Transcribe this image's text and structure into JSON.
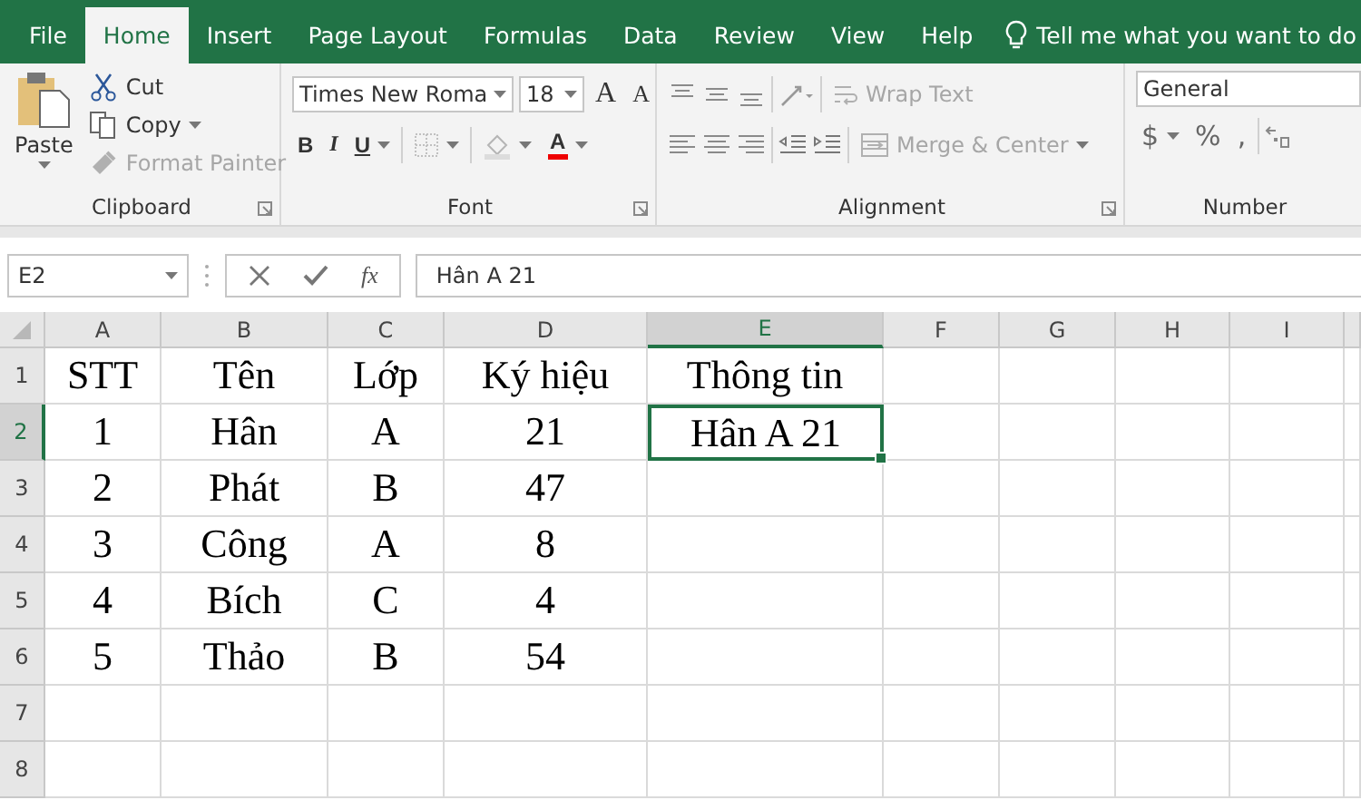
{
  "tabs": [
    {
      "label": "File",
      "selected": false
    },
    {
      "label": "Home",
      "selected": true
    },
    {
      "label": "Insert",
      "selected": false
    },
    {
      "label": "Page Layout",
      "selected": false
    },
    {
      "label": "Formulas",
      "selected": false
    },
    {
      "label": "Data",
      "selected": false
    },
    {
      "label": "Review",
      "selected": false
    },
    {
      "label": "View",
      "selected": false
    },
    {
      "label": "Help",
      "selected": false
    }
  ],
  "tell_me": "Tell me what you want to do",
  "ribbon": {
    "clipboard": {
      "label": "Clipboard",
      "items": [
        {
          "kind": "paste",
          "label": "Paste",
          "disabled": false
        },
        {
          "kind": "cut",
          "label": "Cut",
          "disabled": false
        },
        {
          "kind": "copy",
          "label": "Copy",
          "disabled": false
        },
        {
          "kind": "format_painter",
          "label": "Format Painter",
          "disabled": true
        }
      ]
    },
    "font": {
      "label": "Font",
      "rows": [
        {
          "items": [
            {
              "kind": "font_name",
              "value": "Times New Roma"
            },
            {
              "kind": "font_size",
              "value": "18"
            },
            {
              "kind": "grow",
              "label": "A"
            },
            {
              "kind": "shrink",
              "label": "A"
            }
          ]
        },
        {
          "items": [
            {
              "kind": "bold",
              "label": "B"
            },
            {
              "kind": "italic",
              "label": "I"
            },
            {
              "kind": "underline",
              "label": "U"
            },
            {
              "kind": "borders",
              "disabled": true
            },
            {
              "kind": "fill",
              "disabled": true
            },
            {
              "kind": "font_color",
              "label": "A"
            }
          ]
        }
      ]
    },
    "alignment": {
      "label": "Alignment",
      "rows": [
        {
          "items": [
            {
              "kind": "align_top"
            },
            {
              "kind": "align_middle"
            },
            {
              "kind": "align_bottom"
            },
            {
              "kind": "orientation"
            },
            {
              "kind": "wrap_text",
              "label": "Wrap Text",
              "disabled": true
            }
          ]
        },
        {
          "items": [
            {
              "kind": "align_left"
            },
            {
              "kind": "align_center"
            },
            {
              "kind": "align_right"
            },
            {
              "kind": "outdent"
            },
            {
              "kind": "indent"
            },
            {
              "kind": "merge_center",
              "label": "Merge & Center",
              "disabled": true
            }
          ]
        }
      ]
    },
    "number": {
      "label": "Number",
      "format": "General",
      "items": [
        {
          "kind": "currency",
          "label": "$"
        },
        {
          "kind": "percent",
          "label": "%"
        },
        {
          "kind": "comma",
          "label": ","
        },
        {
          "kind": "decimal"
        }
      ]
    }
  },
  "formula_bar": {
    "name_box": "E2",
    "function_label": "fx",
    "formula": "Hân A 21"
  },
  "grid": {
    "columns": [
      {
        "label": "A",
        "selected": false
      },
      {
        "label": "B",
        "selected": false
      },
      {
        "label": "C",
        "selected": false
      },
      {
        "label": "D",
        "selected": false
      },
      {
        "label": "E",
        "selected": true
      },
      {
        "label": "F",
        "selected": false
      },
      {
        "label": "G",
        "selected": false
      },
      {
        "label": "H",
        "selected": false
      },
      {
        "label": "I",
        "selected": false
      }
    ],
    "rows": [
      {
        "header": "1",
        "selected": false,
        "cells": [
          "STT",
          "Tên",
          "Lớp",
          "Ký hiệu",
          "Thông tin"
        ]
      },
      {
        "header": "2",
        "selected": true,
        "cells": [
          "1",
          "Hân",
          "A",
          "21",
          "Hân A 21"
        ]
      },
      {
        "header": "3",
        "selected": false,
        "cells": [
          "2",
          "Phát",
          "B",
          "47"
        ]
      },
      {
        "header": "4",
        "selected": false,
        "cells": [
          "3",
          "Công",
          "A",
          "8"
        ]
      },
      {
        "header": "5",
        "selected": false,
        "cells": [
          "4",
          "Bích",
          "C",
          "4"
        ]
      },
      {
        "header": "6",
        "selected": false,
        "cells": [
          "5",
          "Thảo",
          "B",
          "54"
        ]
      },
      {
        "header": "7",
        "selected": false
      },
      {
        "header": "8",
        "selected": false
      }
    ]
  }
}
